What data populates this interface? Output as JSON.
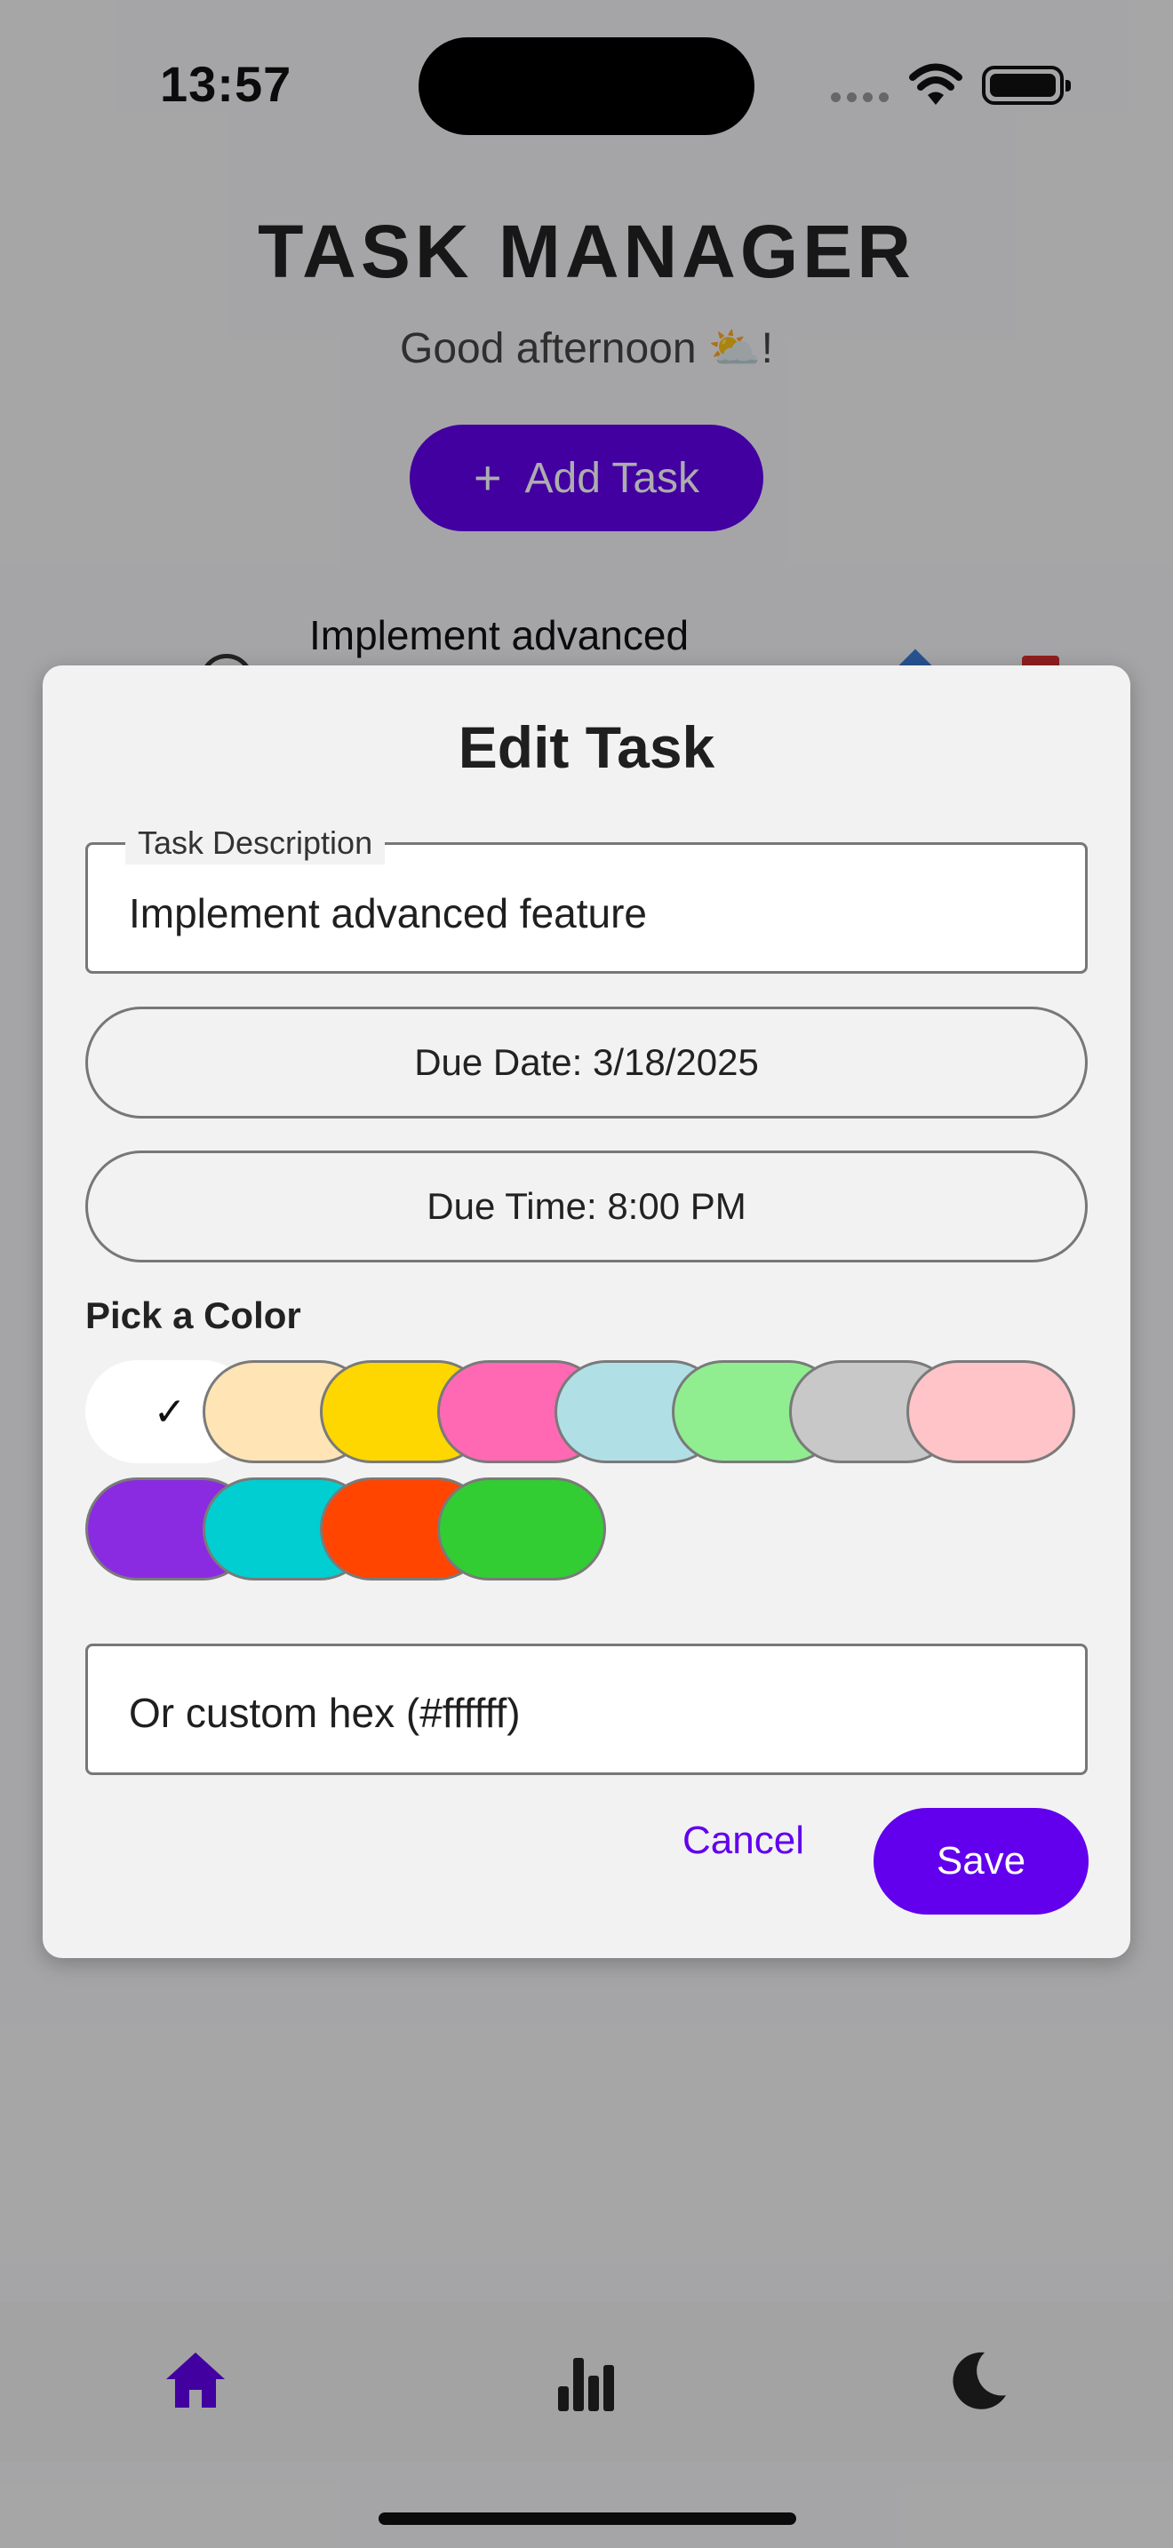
{
  "status_bar": {
    "time": "13:57"
  },
  "app": {
    "title": "TASK MANAGER",
    "greeting": "Good afternoon ⛅!",
    "add_task_label": "Add Task",
    "add_task_icon": "plus-icon",
    "task_preview_title": "Implement advanced"
  },
  "dialog": {
    "title": "Edit Task",
    "description_label": "Task Description",
    "description_value": "Implement advanced feature",
    "due_date_label": "Due Date: 3/18/2025",
    "due_time_label": "Due Time: 8:00 PM",
    "color_label": "Pick a Color",
    "check_glyph": "✓",
    "colors": [
      {
        "name": "white",
        "hex": "#ffffff",
        "selected": true
      },
      {
        "name": "bisque",
        "hex": "#ffe4b5",
        "selected": false
      },
      {
        "name": "gold",
        "hex": "#ffd700",
        "selected": false
      },
      {
        "name": "hot-pink",
        "hex": "#ff69b4",
        "selected": false
      },
      {
        "name": "powder-blue",
        "hex": "#b0e0e6",
        "selected": false
      },
      {
        "name": "light-green",
        "hex": "#90ee90",
        "selected": false
      },
      {
        "name": "silver",
        "hex": "#c8c8c8",
        "selected": false
      },
      {
        "name": "pink",
        "hex": "#ffc4c8",
        "selected": false
      },
      {
        "name": "blue-violet",
        "hex": "#8a2be2",
        "selected": false
      },
      {
        "name": "dark-turquoise",
        "hex": "#00ced1",
        "selected": false
      },
      {
        "name": "orange-red",
        "hex": "#ff4500",
        "selected": false
      },
      {
        "name": "lime-green",
        "hex": "#32cd32",
        "selected": false
      }
    ],
    "hex_placeholder": "Or custom hex (#ffffff)",
    "cancel_label": "Cancel",
    "save_label": "Save"
  },
  "bottom_nav": {
    "items": [
      {
        "icon": "home-icon",
        "active": true
      },
      {
        "icon": "bar-chart-icon",
        "active": false
      },
      {
        "icon": "moon-icon",
        "active": false
      }
    ]
  },
  "theme": {
    "accent": "#6200ee"
  }
}
